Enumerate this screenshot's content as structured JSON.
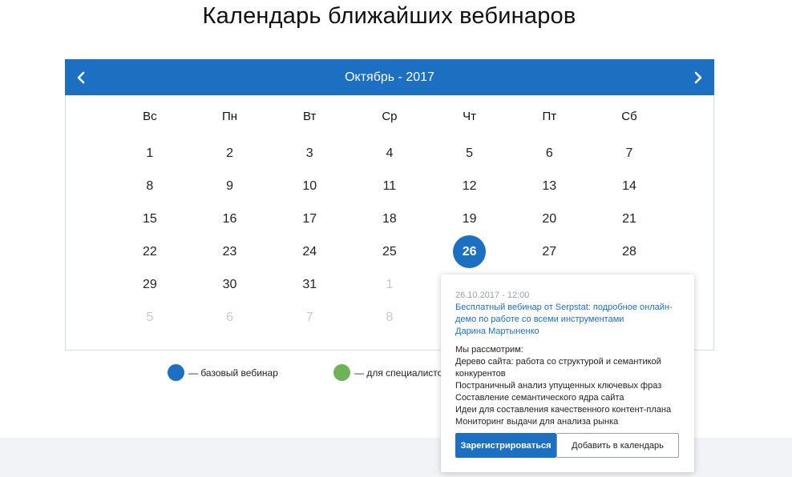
{
  "page": {
    "title": "Календарь ближайших вебинаров"
  },
  "calendar": {
    "month_label": "Октябрь - 2017",
    "weekdays": [
      "Вс",
      "Пн",
      "Вт",
      "Ср",
      "Чт",
      "Пт",
      "Сб"
    ],
    "weeks": [
      [
        {
          "d": "1"
        },
        {
          "d": "2"
        },
        {
          "d": "3"
        },
        {
          "d": "4"
        },
        {
          "d": "5"
        },
        {
          "d": "6"
        },
        {
          "d": "7"
        }
      ],
      [
        {
          "d": "8"
        },
        {
          "d": "9"
        },
        {
          "d": "10"
        },
        {
          "d": "11"
        },
        {
          "d": "12"
        },
        {
          "d": "13"
        },
        {
          "d": "14"
        }
      ],
      [
        {
          "d": "15"
        },
        {
          "d": "16"
        },
        {
          "d": "17"
        },
        {
          "d": "18"
        },
        {
          "d": "19"
        },
        {
          "d": "20"
        },
        {
          "d": "21"
        }
      ],
      [
        {
          "d": "22"
        },
        {
          "d": "23"
        },
        {
          "d": "24"
        },
        {
          "d": "25"
        },
        {
          "d": "26",
          "event": true
        },
        {
          "d": "27"
        },
        {
          "d": "28"
        }
      ],
      [
        {
          "d": "29"
        },
        {
          "d": "30"
        },
        {
          "d": "31"
        },
        {
          "d": "1",
          "muted": true
        },
        {
          "d": "",
          "muted": true
        },
        {
          "d": "",
          "muted": true
        },
        {
          "d": "",
          "muted": true
        }
      ],
      [
        {
          "d": "5",
          "muted": true
        },
        {
          "d": "6",
          "muted": true
        },
        {
          "d": "7",
          "muted": true
        },
        {
          "d": "8",
          "muted": true
        },
        {
          "d": "",
          "muted": true
        },
        {
          "d": "",
          "muted": true
        },
        {
          "d": "",
          "muted": true
        }
      ]
    ],
    "prev_icon": "chevron-left-icon",
    "next_icon": "chevron-right-icon"
  },
  "legend": [
    {
      "label": "— базовый вебинар",
      "color": "#1c6fc1"
    },
    {
      "label": "— для специалистов",
      "color": "#6db35a"
    }
  ],
  "colors": {
    "accent": "#1c6fc1",
    "green": "#6db35a"
  },
  "popup": {
    "date": "26.10.2017 - 12:00",
    "title": "Бесплатный вебинар от Serpstat: подробное онлайн-демо по работе со всеми инструментами",
    "speaker": "Дарина Мартыненко",
    "desc_lines": [
      "Мы рассмотрим:",
      "Дерево сайта: работа со структурой и семантикой конкурентов",
      "Постраничный анализ упущенных ключевых фраз",
      "Составление семантического ядра сайта",
      "Идеи для составления качественного контент-плана",
      "Мониторинг выдачи для анализа рынка"
    ],
    "register_label": "Зарегистрироваться",
    "add_label": "Добавить в календарь"
  }
}
